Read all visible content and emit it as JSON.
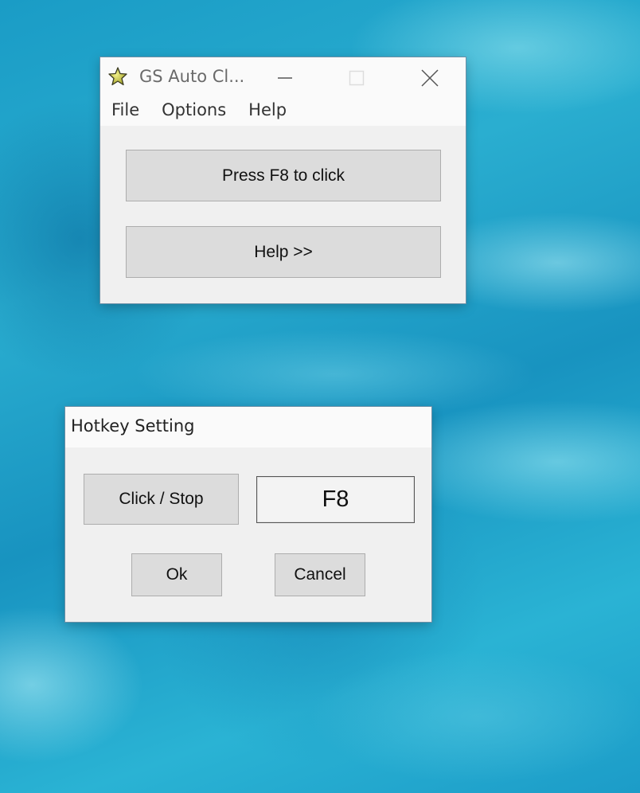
{
  "main_window": {
    "title": "GS Auto Cl...",
    "icon": "star-icon",
    "controls": {
      "minimize": "—",
      "maximize": "☐",
      "close": "✕"
    },
    "menu": [
      {
        "label": "File"
      },
      {
        "label": "Options"
      },
      {
        "label": "Help"
      }
    ],
    "buttons": {
      "press_label": "Press F8 to click",
      "help_label": "Help >>"
    }
  },
  "hotkey_dialog": {
    "title": "Hotkey Setting",
    "action_label": "Click / Stop",
    "hotkey_value": "F8",
    "ok_label": "Ok",
    "cancel_label": "Cancel"
  }
}
